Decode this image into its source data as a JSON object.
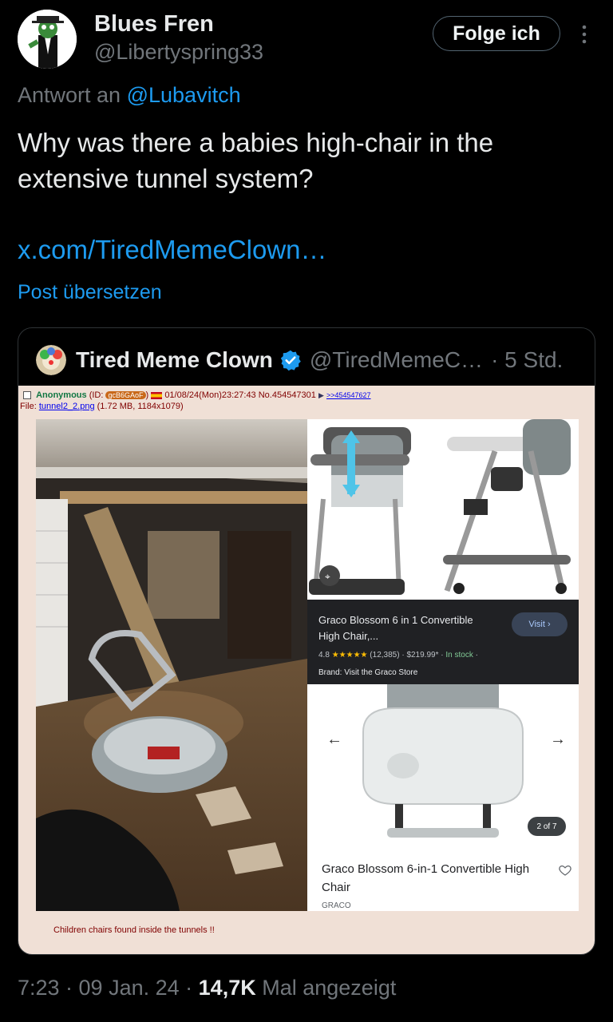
{
  "author": {
    "display_name": "Blues Fren",
    "handle": "@Libertyspring33"
  },
  "follow_label": "Folge ich",
  "reply": {
    "prefix": "Antwort an",
    "mention": "@Lubavitch"
  },
  "tweet": {
    "text": "Why was there a babies high-chair in the extensive tunnel system?",
    "link": "x.com/TiredMemeClown…",
    "translate_label": "Post übersetzen"
  },
  "quote": {
    "display_name": "Tired Meme Clown",
    "handle": "@TiredMemeC…",
    "time": "· 5 Std.",
    "chan": {
      "name": "Anonymous",
      "id_prefix": "(ID:",
      "id": "gcB6GAoF",
      "id_suffix": ")",
      "datetime": "01/08/24(Mon)23:27:43 No.454547301",
      "reply_ref": ">>454547627",
      "file_label": "File:",
      "file_name": "tunnel2_2.png",
      "file_meta": "(1.72 MB, 1184x1079)",
      "caption": "Children chairs found inside the tunnels !!"
    },
    "product": {
      "title": "Graco Blossom 6 in 1 Convertible High Chair,...",
      "visit_label": "Visit ›",
      "rating": "4.8",
      "stars": "★★★★★",
      "reviews": "(12,385)",
      "price": "$219.99*",
      "stock": "In stock",
      "brand_line": "Brand: Visit the Graco Store",
      "page_badge": "2 of 7",
      "name": "Graco Blossom 6-in-1 Convertible High Chair",
      "brand": "GRACO"
    }
  },
  "footer": {
    "time": "7:23 · 09 Jan. 24 ·",
    "views": "14,7K",
    "views_label": "Mal angezeigt"
  },
  "colors": {
    "accent": "#1d9bf0",
    "muted": "#71767b",
    "chan_bg": "#f0e0d6"
  }
}
